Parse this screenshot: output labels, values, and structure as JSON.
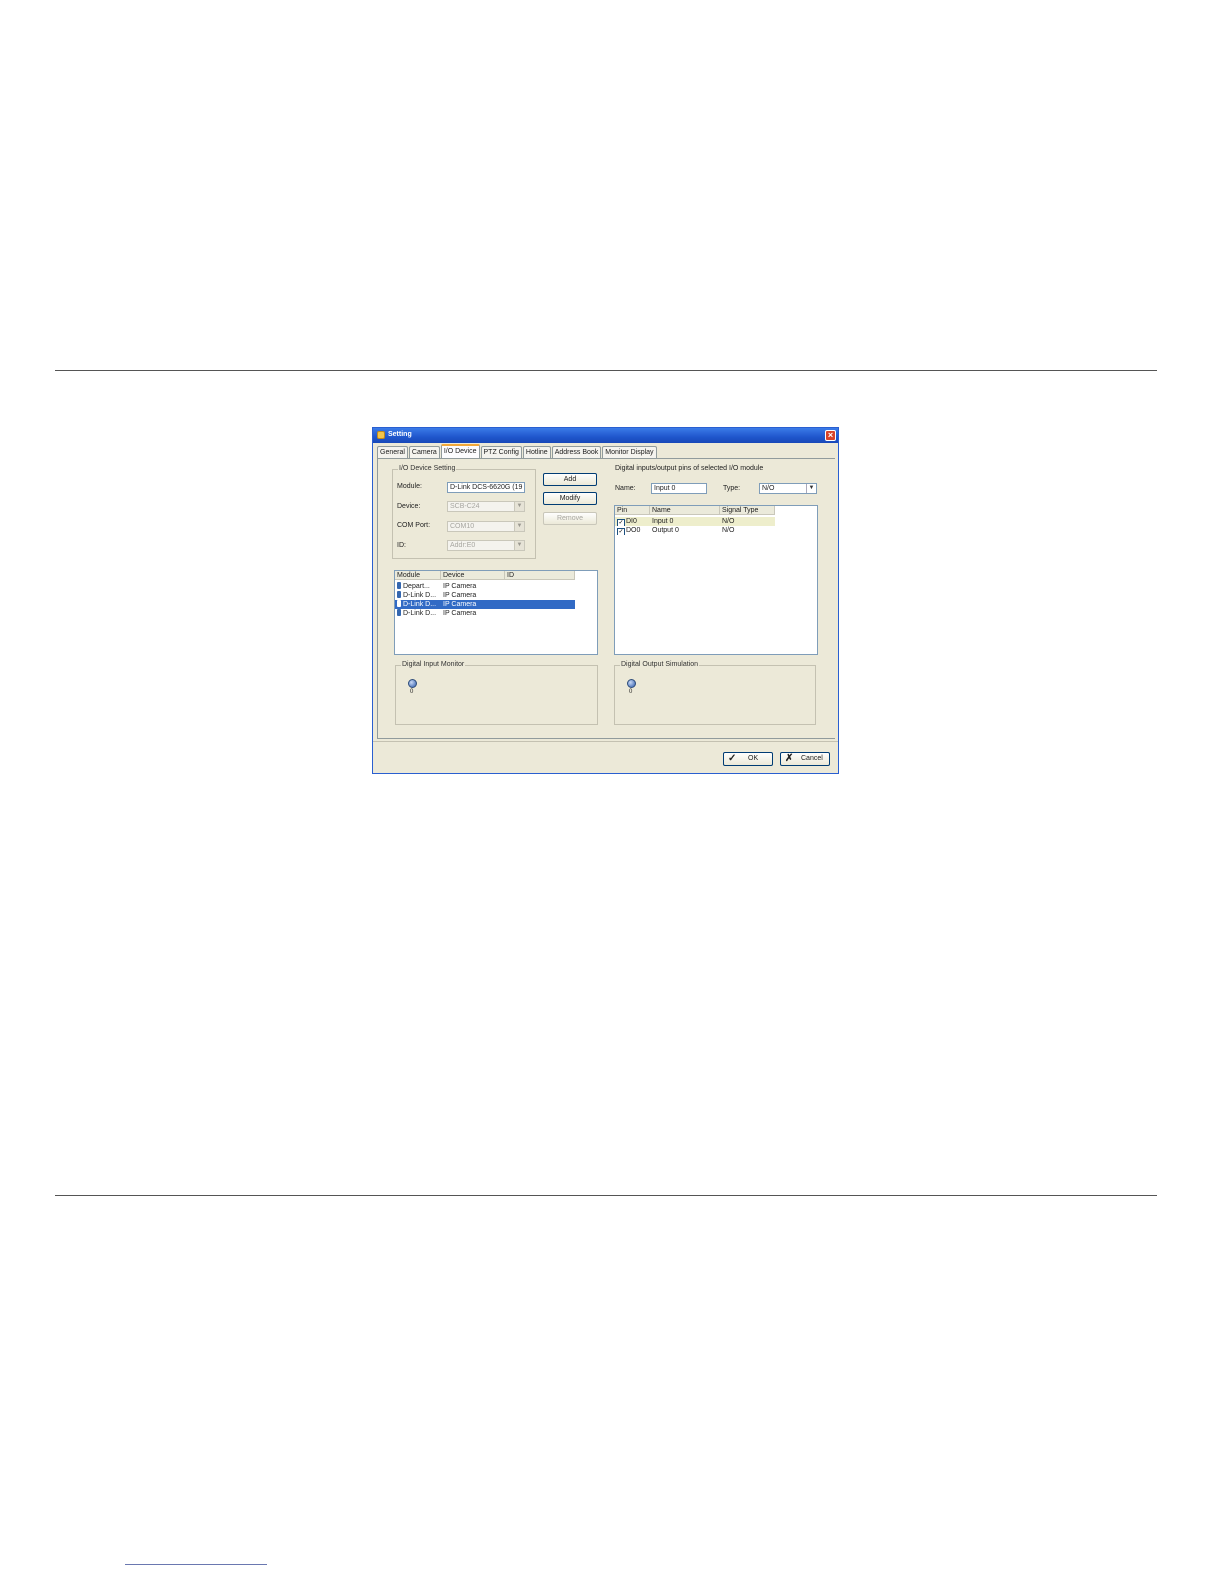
{
  "window": {
    "title": "Setting",
    "close_label": "×"
  },
  "tabs": [
    {
      "label": "General"
    },
    {
      "label": "Camera"
    },
    {
      "label": "I/O Device"
    },
    {
      "label": "PTZ Config"
    },
    {
      "label": "Hotline"
    },
    {
      "label": "Address Book"
    },
    {
      "label": "Monitor Display"
    }
  ],
  "active_tab": "I/O Device",
  "io_device_setting": {
    "legend": "I/O Device Setting",
    "module_label": "Module:",
    "module_value": "D-Link DCS-6620G (19",
    "device_label": "Device:",
    "device_value": "SCB-C24",
    "com_port_label": "COM Port:",
    "com_port_value": "COM10",
    "id_label": "ID:",
    "id_value": "Addr:E0"
  },
  "buttons": {
    "add": "Add",
    "modify": "Modify",
    "remove": "Remove",
    "ok": "OK",
    "cancel": "Cancel"
  },
  "module_list": {
    "columns": [
      "Module",
      "Device",
      "ID"
    ],
    "rows": [
      {
        "module": "Depart...",
        "device": "IP Camera",
        "id": ""
      },
      {
        "module": "D-Link D...",
        "device": "IP Camera",
        "id": ""
      },
      {
        "module": "D-Link D...",
        "device": "IP Camera",
        "id": ""
      },
      {
        "module": "D-Link D...",
        "device": "IP Camera",
        "id": ""
      }
    ],
    "selected_index": 2
  },
  "pins": {
    "caption": "Digital inputs/output pins of selected I/O module",
    "name_label": "Name:",
    "name_value": "Input 0",
    "type_label": "Type:",
    "type_value": "N/O",
    "columns": [
      "Pin",
      "Name",
      "Signal Type"
    ],
    "rows": [
      {
        "checked": true,
        "pin": "DI0",
        "name": "Input 0",
        "signal_type": "N/O"
      },
      {
        "checked": true,
        "pin": "DO0",
        "name": "Output 0",
        "signal_type": "N/O"
      }
    ]
  },
  "digital_input_monitor": {
    "legend": "Digital Input Monitor",
    "indicator_label": "0"
  },
  "digital_output_simulation": {
    "legend": "Digital Output Simulation",
    "indicator_label": "0"
  },
  "colors": {
    "title_bar": "#1f56cc",
    "window_bg": "#ece9d8",
    "selection": "#316ac5"
  }
}
